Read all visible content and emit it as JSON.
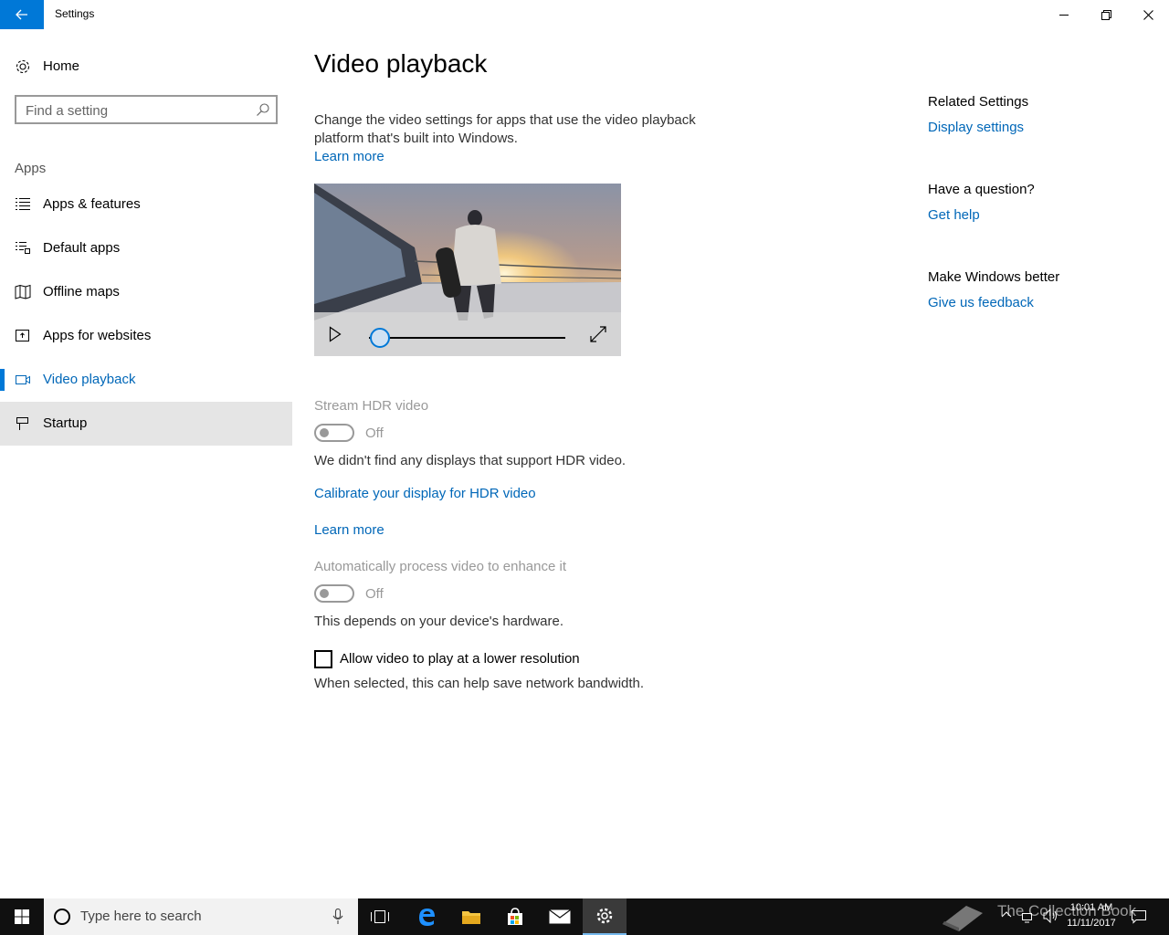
{
  "window": {
    "title": "Settings"
  },
  "sidebar": {
    "home_label": "Home",
    "search_placeholder": "Find a setting",
    "section_header": "Apps",
    "items": [
      {
        "label": "Apps & features",
        "icon": "list-icon"
      },
      {
        "label": "Default apps",
        "icon": "default-apps-icon"
      },
      {
        "label": "Offline maps",
        "icon": "map-icon"
      },
      {
        "label": "Apps for websites",
        "icon": "link-icon"
      },
      {
        "label": "Video playback",
        "icon": "video-icon",
        "active": true
      },
      {
        "label": "Startup",
        "icon": "startup-icon",
        "hover": true
      }
    ]
  },
  "main": {
    "title": "Video playback",
    "description": "Change the video settings for apps that use the video playback platform that's built into Windows.",
    "learn_more_1": "Learn more",
    "video_preview": {
      "progress": 0
    },
    "hdr": {
      "label": "Stream HDR video",
      "state": "Off",
      "note": "We didn't find any displays that support HDR video.",
      "calibrate_link": "Calibrate your display for HDR video",
      "learn_more": "Learn more"
    },
    "auto_process": {
      "label": "Automatically process video to enhance it",
      "state": "Off",
      "note": "This depends on your device's hardware."
    },
    "low_res": {
      "label": "Allow video to play at a lower resolution",
      "checked": false,
      "note": "When selected, this can help save network bandwidth."
    }
  },
  "related": {
    "heading": "Related Settings",
    "display_link": "Display settings",
    "question_heading": "Have a question?",
    "help_link": "Get help",
    "better_heading": "Make Windows better",
    "feedback_link": "Give us feedback"
  },
  "taskbar": {
    "search_placeholder": "Type here to search",
    "time": "10:01 AM",
    "date": "11/11/2017",
    "watermark": "The Collection Book"
  },
  "colors": {
    "accent": "#0078d7",
    "link": "#0067b8",
    "disabled": "#999999"
  }
}
